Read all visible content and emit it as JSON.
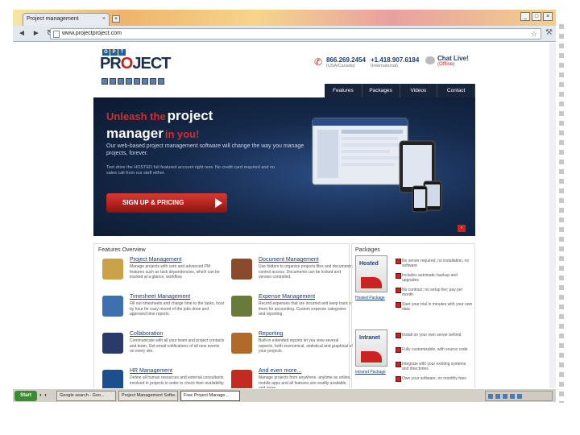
{
  "browser": {
    "tab_title": "Project management",
    "address": "www.projectproject.com"
  },
  "site": {
    "logo_top": [
      "O",
      "P",
      "T"
    ],
    "logo_word_pre": "PR",
    "logo_word_o": "O",
    "logo_word_post": "JECT",
    "phone1": {
      "number": "866.269.2454",
      "sub": "(USA/Canada)"
    },
    "phone2": {
      "number": "+1.418.907.6184",
      "sub": "(International)"
    },
    "chat": {
      "title": "Chat Live!",
      "status": "(Offline)"
    },
    "nav": [
      "Features",
      "Packages",
      "Videos",
      "Contact"
    ]
  },
  "hero": {
    "line1_red": "Unleash the",
    "line1_white": "project",
    "line2_white": "manager",
    "line2_red": "in you!",
    "para1": "Our web-based project management software will change the way you manage projects, forever.",
    "para2": "Test drive the HOSTED full featured account right now. No credit card required and no sales call from our staff either.",
    "cta": "SIGN UP & PRICING"
  },
  "features": {
    "heading": "Features Overview",
    "items": [
      {
        "title": "Project Management",
        "desc": "Manage projects with core and advanced PM features such as task dependencies, which can be tracked at a glance, workflow.",
        "color": "#caa24a"
      },
      {
        "title": "Document Management",
        "desc": "Use folders to organize projects files and documents; control access. Documents can be locked and version controlled.",
        "color": "#8b4a2b"
      },
      {
        "title": "Timesheet Management",
        "desc": "Fill out timesheets and charge time to the tasks, hour by hour for easy record of the jobs done and approved time reports.",
        "color": "#3e6fb0"
      },
      {
        "title": "Expense Management",
        "desc": "Record expenses that are incurred and keep track of them for accounting. Custom expense categories and reporting.",
        "color": "#6a7a3a"
      },
      {
        "title": "Collaboration",
        "desc": "Communicate with all your team and project contacts and team. Get email notifications of all new events on every site.",
        "color": "#2a3a6a"
      },
      {
        "title": "Reporting",
        "desc": "Built-in extended reports let you view several aspects, both economical, statistical and graphical of your projects.",
        "color": "#b06a2a"
      },
      {
        "title": "HR Management",
        "desc": "Define all human resources and external consultants involved in projects in order to check their availability.",
        "color": "#1d4f8f"
      },
      {
        "title": "And even more...",
        "desc": "Manage projects from anywhere, anytime as online, mobile apps and all features are readily available, and more.",
        "color": "#c22a22"
      }
    ]
  },
  "packages": {
    "heading": "Packages",
    "items": [
      {
        "box": "Hosted",
        "label": "Hosted Package",
        "checks": [
          "No server required, no installation, no software",
          "Includes automatic backup and upgrades",
          "No contract; no setup fee; pay per month",
          "Start your trial in minutes with your own data"
        ]
      },
      {
        "box": "Intranet",
        "label": "Intranet Package",
        "checks": [
          "Install on your own server behind",
          "Fully customizable, with source code",
          "Integrate with your existing systems and directories",
          "Own your software, no monthly fees"
        ]
      }
    ]
  },
  "taskbar": {
    "start": "Start",
    "items": [
      "Google search - Goo...",
      "Project Management Softw...",
      "Free Project Manage..."
    ]
  }
}
